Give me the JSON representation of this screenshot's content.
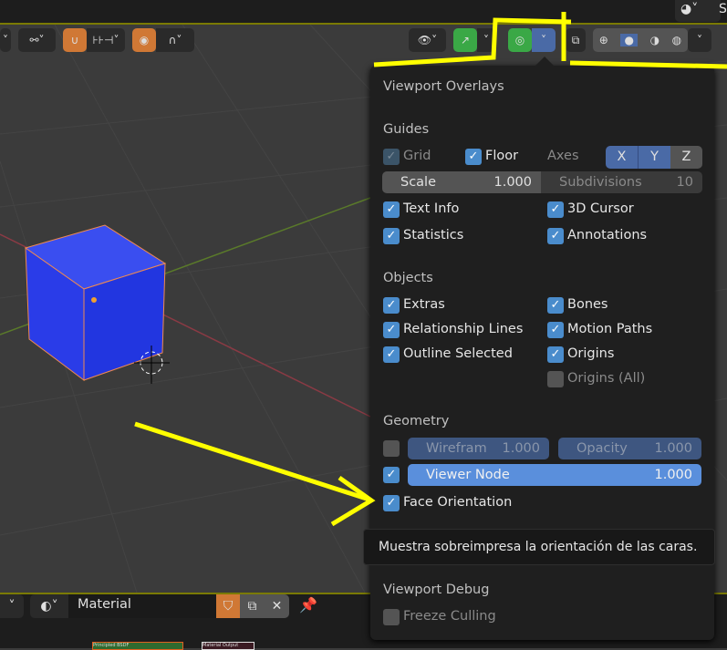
{
  "header": {
    "right_label": "S"
  },
  "material_bar": {
    "name": "Material",
    "node_1": "Principled BSDF",
    "node_2": "Material Output"
  },
  "overlays": {
    "title": "Viewport Overlays",
    "guides": {
      "heading": "Guides",
      "grid": "Grid",
      "floor": "Floor",
      "axes": "Axes",
      "x": "X",
      "y": "Y",
      "z": "Z",
      "scale_label": "Scale",
      "scale_value": "1.000",
      "subdiv_label": "Subdivisions",
      "subdiv_value": "10",
      "text_info": "Text Info",
      "cursor": "3D Cursor",
      "statistics": "Statistics",
      "annotations": "Annotations"
    },
    "objects": {
      "heading": "Objects",
      "extras": "Extras",
      "bones": "Bones",
      "relationship": "Relationship Lines",
      "motion": "Motion Paths",
      "outline": "Outline Selected",
      "origins": "Origins",
      "origins_all": "Origins (All)"
    },
    "geometry": {
      "heading": "Geometry",
      "wireframe_label": "Wirefram",
      "wireframe_value": "1.000",
      "opacity_label": "Opacity",
      "opacity_value": "1.000",
      "viewer_label": "Viewer Node",
      "viewer_value": "1.000",
      "face_orientation": "Face Orientation"
    },
    "tooltip": "Muestra sobreimpresa la orientación de las caras.",
    "debug": {
      "heading": "Viewport Debug",
      "freeze": "Freeze Culling"
    }
  },
  "colors": {
    "accent": "#4a8ccc",
    "annotation": "#ffff00",
    "snap": "#d07835",
    "gizmo": "#3aa846"
  }
}
